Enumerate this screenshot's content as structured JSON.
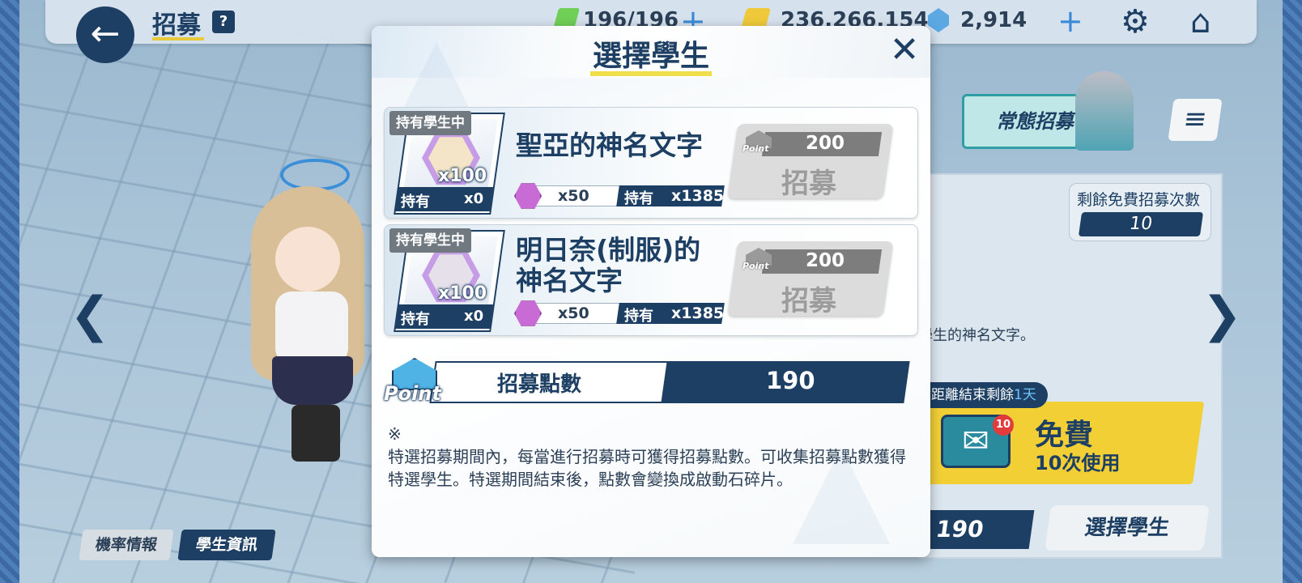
{
  "colors": {
    "navy": "#1d3f63",
    "accent_yellow": "#f0de4b",
    "disabled_gray": "#dcdcdc",
    "free_yellow": "#f2cf35"
  },
  "topbar": {
    "title": "招募",
    "help": "?",
    "ap": "196/196",
    "credits": "236,266,154",
    "pyroxene": "2,914",
    "plus": "+",
    "icons": [
      "back-arrow-icon",
      "ap-icon",
      "credit-icon",
      "pyroxene-icon",
      "gear-icon",
      "home-icon"
    ]
  },
  "background": {
    "banner_title": "常態招募",
    "free_count_label": "剩餘免費招募次數",
    "free_count": "10",
    "desc_tail": "學生的神名文字。",
    "remain_prefix": "距離結束剩餘",
    "remain_days": "1天",
    "free_title": "免費",
    "free_sub": "10次使用",
    "mail_badge": "10",
    "points": "190",
    "select_button": "選擇學生",
    "tab_rate": "機率情報",
    "tab_student": "學生資訊"
  },
  "dialog": {
    "title": "選擇學生",
    "close": "✕",
    "items": [
      {
        "flag": "持有學生中",
        "qty": "x100",
        "own_label": "持有",
        "own_value": "x0",
        "name_line1": "聖亞的神名文字",
        "name_line2": "",
        "cost": "x50",
        "cost_own_label": "持有",
        "cost_own_value": "x1385",
        "point_cost": "200",
        "point_text": "Point",
        "button": "招募"
      },
      {
        "flag": "持有學生中",
        "qty": "x100",
        "own_label": "持有",
        "own_value": "x0",
        "name_line1": "明日奈(制服)的",
        "name_line2": "神名文字",
        "cost": "x50",
        "cost_own_label": "持有",
        "cost_own_value": "x1385",
        "point_cost": "200",
        "point_text": "Point",
        "button": "招募"
      }
    ],
    "points": {
      "icon_text": "Point",
      "label": "招募點數",
      "value": "190"
    },
    "note_mark": "※",
    "note": "特選招募期間內，每當進行招募時可獲得招募點數。可收集招募點數獲得特選學生。特選期間結束後，點數會變換成啟動石碎片。"
  }
}
